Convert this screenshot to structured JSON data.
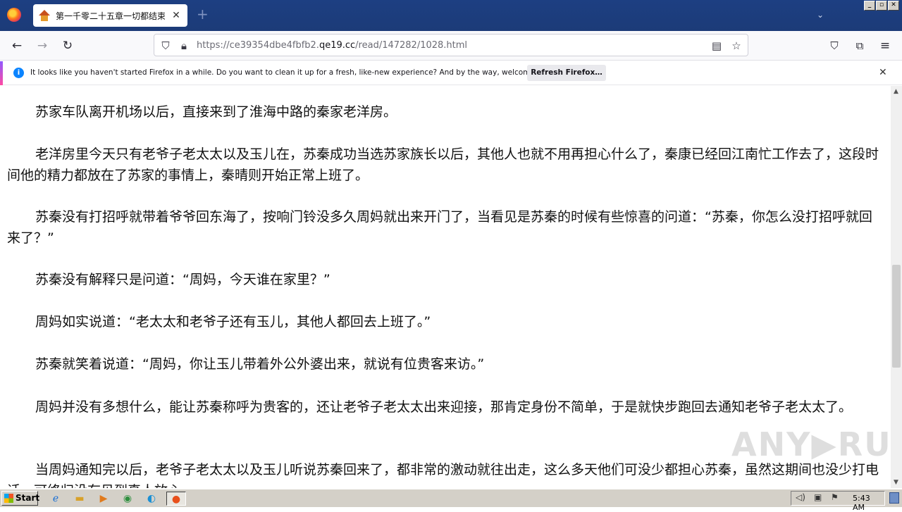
{
  "browser": {
    "tab": {
      "title": "第一千零二十五章一切都结束了_",
      "close": "✕"
    },
    "newtab": "+",
    "list_all": "⌄",
    "window_buttons": [
      "_",
      "▫",
      "✕"
    ]
  },
  "navbar": {
    "url_prefix": "https://ce39354dbe4fbfb2.",
    "url_domain": "qe19.cc",
    "url_path": "/read/147282/1028.html"
  },
  "notification": {
    "message": "It looks like you haven't started Firefox in a while. Do you want to clean it up for a fresh, like-new experience? And by the way, welcome back!",
    "button": "Refresh Firefox…",
    "close": "✕"
  },
  "content": {
    "paragraphs": [
      "苏家车队离开机场以后，直接来到了淮海中路的秦家老洋房。",
      "老洋房里今天只有老爷子老太太以及玉儿在，苏秦成功当选苏家族长以后，其他人也就不用再担心什么了，秦康已经回江南忙工作去了，这段时间他的精力都放在了苏家的事情上，秦晴则开始正常上班了。",
      "苏秦没有打招呼就带着爷爷回东海了，按响门铃没多久周妈就出来开门了，当看见是苏秦的时候有些惊喜的问道：“苏秦，你怎么没打招呼就回来了？”",
      "苏秦没有解释只是问道：“周妈，今天谁在家里？”",
      "周妈如实说道：“老太太和老爷子还有玉儿，其他人都回去上班了。”",
      "苏秦就笑着说道：“周妈，你让玉儿带着外公外婆出来，就说有位贵客来访。”",
      "周妈并没有多想什么，能让苏秦称呼为贵客的，还让老爷子老太太出来迎接，那肯定身份不简单，于是就快步跑回去通知老爷子老太太了。",
      "当周妈通知完以后，老爷子老太太以及玉儿听说苏秦回来了，都非常的激动就往出走，这么多天他们可没少都担心苏秦，虽然这期间也没少打电话，可终归没有见到真人放心。"
    ]
  },
  "watermark": "ANY▶RUN",
  "taskbar": {
    "start_label": "Start",
    "clock": "5:43 AM"
  }
}
